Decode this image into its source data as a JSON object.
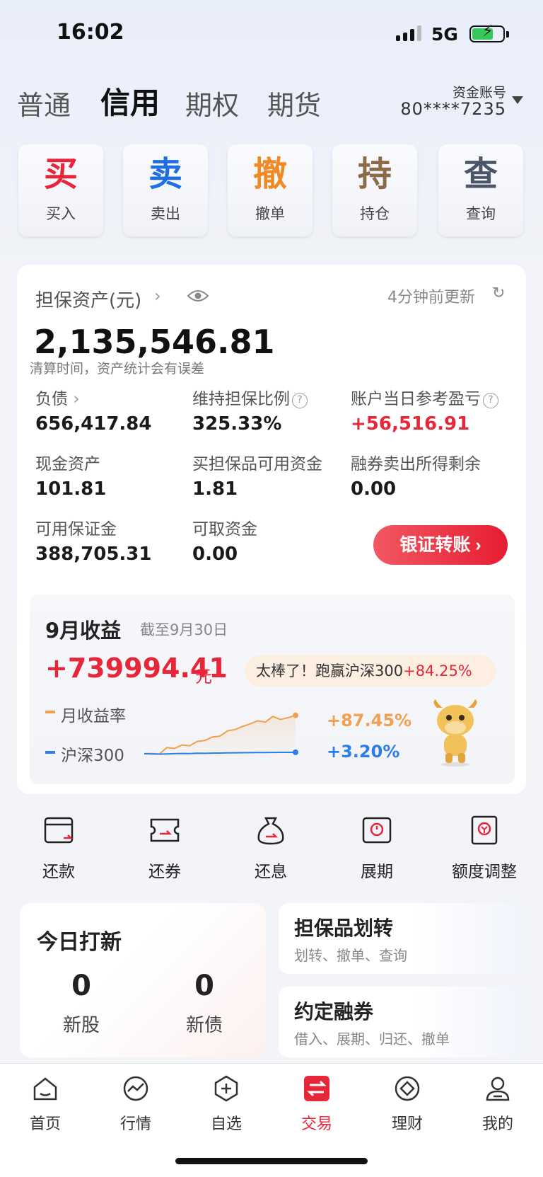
{
  "status": {
    "time": "16:02",
    "network": "5G"
  },
  "account_tabs": [
    {
      "label": "普通",
      "active": false
    },
    {
      "label": "信用",
      "active": true
    },
    {
      "label": "期权",
      "active": false
    },
    {
      "label": "期货",
      "active": false
    }
  ],
  "account": {
    "label": "资金账号",
    "number": "80****7235"
  },
  "actions": [
    {
      "big": "买",
      "label": "买入",
      "color": "#e8263a"
    },
    {
      "big": "卖",
      "label": "卖出",
      "color": "#1f6fe0"
    },
    {
      "big": "撤",
      "label": "撤单",
      "color": "#f08a24"
    },
    {
      "big": "持",
      "label": "持仓",
      "color": "#8a6a47"
    },
    {
      "big": "查",
      "label": "查询",
      "color": "#4a5568"
    }
  ],
  "assets": {
    "title": "担保资产(元)",
    "updated": "4分钟前更新",
    "total": "2,135,546.81",
    "note": "清算时间，资产统计会有误差",
    "fields": [
      {
        "label": "负债",
        "value": "656,417.84"
      },
      {
        "label": "维持担保比例",
        "value": "325.33%"
      },
      {
        "label": "账户当日参考盈亏",
        "value": "+56,516.91"
      },
      {
        "label": "现金资产",
        "value": "101.81"
      },
      {
        "label": "买担保品可用资金",
        "value": "1.81"
      },
      {
        "label": "融券卖出所得剩余",
        "value": "0.00"
      },
      {
        "label": "可用保证金",
        "value": "388,705.31"
      },
      {
        "label": "可取资金",
        "value": "0.00"
      }
    ],
    "transfer_button": "银证转账"
  },
  "income": {
    "title": "9月收益",
    "as_of": "截至9月30日",
    "amount": "+739994.41",
    "unit": "元",
    "bubble_text": "太棒了！跑赢沪深300",
    "bubble_value": "+84.25%",
    "legend": [
      {
        "name": "月收益率",
        "value": "+87.45%",
        "color": "#f0a050"
      },
      {
        "name": "沪深300",
        "value": "+3.20%",
        "color": "#2b7de9"
      }
    ]
  },
  "chart_data": {
    "type": "line",
    "series": [
      {
        "name": "月收益率",
        "values": [
          0,
          0.5,
          -1,
          14,
          12,
          20,
          18,
          28,
          30,
          38,
          40,
          52,
          55,
          62,
          68,
          75,
          72,
          85,
          78,
          82,
          87.45
        ]
      },
      {
        "name": "沪深300",
        "values": [
          0,
          -0.5,
          -1,
          -0.5,
          0,
          0.5,
          0.2,
          1,
          0.8,
          1.2,
          1.5,
          1.8,
          2,
          2.2,
          2.4,
          2.6,
          2.7,
          2.9,
          3.0,
          3.1,
          3.2
        ]
      }
    ],
    "ylim": [
      -5,
      95
    ]
  },
  "quick_actions": [
    {
      "label": "还款",
      "icon": "repay-icon"
    },
    {
      "label": "还券",
      "icon": "return-securities-icon"
    },
    {
      "label": "还息",
      "icon": "pay-interest-icon"
    },
    {
      "label": "展期",
      "icon": "extension-icon"
    },
    {
      "label": "额度调整",
      "icon": "quota-adjust-icon"
    }
  ],
  "ipo": {
    "title": "今日打新",
    "items": [
      {
        "count": "0",
        "label": "新股"
      },
      {
        "count": "0",
        "label": "新债"
      }
    ]
  },
  "mini_cards": [
    {
      "title": "担保品划转",
      "subtitle": "划转、撤单、查询"
    },
    {
      "title": "约定融券",
      "subtitle": "借入、展期、归还、撤单"
    }
  ],
  "tabbar": [
    {
      "label": "首页",
      "icon": "home-icon",
      "active": false
    },
    {
      "label": "行情",
      "icon": "market-icon",
      "active": false
    },
    {
      "label": "自选",
      "icon": "watchlist-icon",
      "active": false
    },
    {
      "label": "交易",
      "icon": "trade-icon",
      "active": true
    },
    {
      "label": "理财",
      "icon": "wealth-icon",
      "active": false
    },
    {
      "label": "我的",
      "icon": "profile-icon",
      "active": false
    }
  ]
}
